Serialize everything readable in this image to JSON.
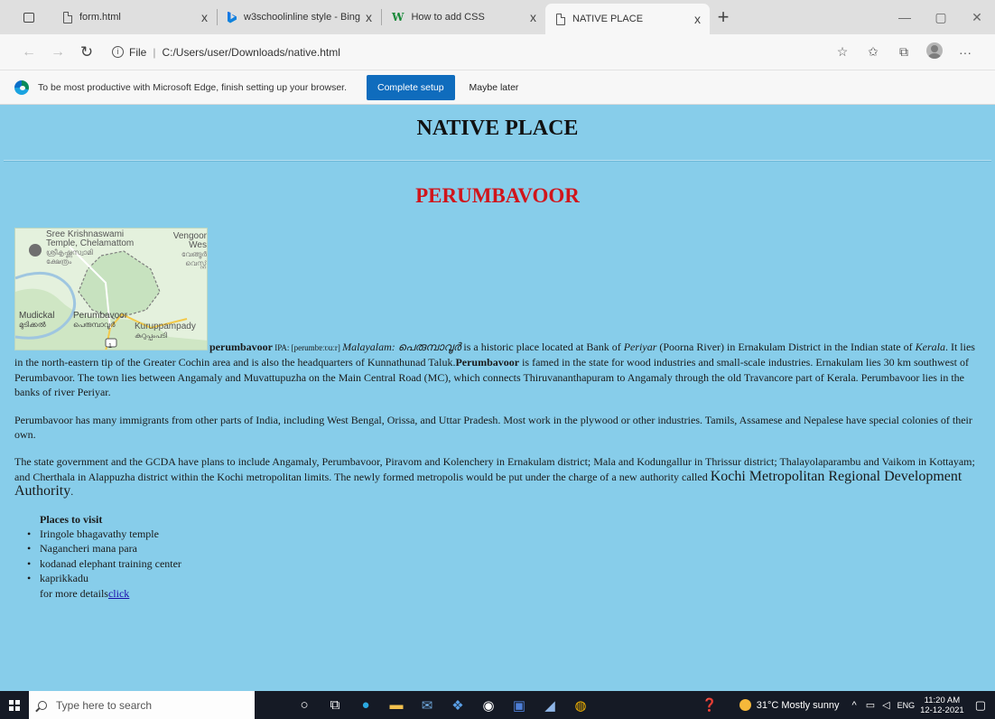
{
  "browser": {
    "tabs": [
      {
        "label": "form.html",
        "icon": "page-icon",
        "active": false
      },
      {
        "label": "w3schoolinline style - Bing",
        "icon": "bing-icon",
        "active": false
      },
      {
        "label": "How to add CSS",
        "icon": "w3-icon",
        "active": false
      },
      {
        "label": "NATIVE PLACE",
        "icon": "page-icon",
        "active": true
      }
    ],
    "tab_close": "x",
    "new_tab": "+",
    "address": {
      "scheme": "File",
      "separator": "|",
      "url": "C:/Users/user/Downloads/native.html"
    },
    "infobar": {
      "message": "To be most productive with Microsoft Edge, finish setting up your browser.",
      "primary_button": "Complete setup",
      "secondary_button": "Maybe later"
    }
  },
  "page": {
    "title": "NATIVE PLACE",
    "place_heading": "PERUMBAVOOR",
    "map_labels": {
      "temple_line1": "Sree Krishnaswami",
      "temple_line2": "Temple, Chelamattom",
      "temple_ml": "ശ്രീകൃഷ്ണസ്വാമി",
      "temple_ml2": "ക്ഷേത്രം",
      "vengoor": "Vengoor Wes",
      "vengoor_ml": "വേങ്ങൂർ",
      "vengoor_ml2": "വെസ്റ്റ്",
      "mudickal": "Mudickal",
      "mudickal_ml": "മുടിക്കൽ",
      "perumbavoor": "Perumbavoor",
      "perumbavoor_ml": "പെരുമ്പാവൂർ",
      "kuruppampady": "Kuruppampady",
      "kuruppampady_ml": "കുറുപ്പംപടി",
      "route": "1"
    },
    "para1": {
      "name": "perumbavoor",
      "ipa": " IPA: [perumbɐːʋuːr] ",
      "lang": "Malayalam: ",
      "ml_name": "പെരുമ്പാവൂർ",
      "t1": " is a historic place located at Bank of ",
      "periyar": "Periyar",
      "t2": " (Poorna River) in Ernakulam District in the Indian state of ",
      "kerala": "Kerala",
      "t3": ". It lies in the north-eastern tip of the Greater Cochin area and is also the headquarters of Kunnathunad Taluk.",
      "name2": "Perumbavoor",
      "t4": " is famed in the state for wood industries and small-scale industries. Ernakulam lies 30 km southwest of Perumbavoor. The town lies between Angamaly and Muvattupuzha on the Main Central Road (MC), which connects Thiruvananthapuram to Angamaly through the old Travancore part of Kerala. Perumbavoor lies in the banks of river Periyar."
    },
    "para2": "Perumbavoor has many immigrants from other parts of India, including West Bengal, Orissa, and Uttar Pradesh. Most work in the plywood or other industries. Tamils, Assamese and Nepalese have special colonies of their own.",
    "para3": {
      "text": "The state government and the GCDA have plans to include Angamaly, Perumbavoor, Piravom and Kolenchery in Ernakulam district; Mala and Kodungallur in Thrissur district; Thalayolaparambu and Vaikom in Kottayam; and Cherthala in Alappuzha district within the Kochi metropolitan limits. The newly formed metropolis would be put under the charge of a new authority called ",
      "authority": "Kochi Metropolitan Regional Development Authority",
      "end": "."
    },
    "places": {
      "title": "Places to visit",
      "items": [
        "Iringole bhagavathy temple",
        "Nagancheri mana para",
        "kodanad elephant training center",
        "kaprikkadu"
      ],
      "more_text": "for more details",
      "link_text": "click"
    }
  },
  "taskbar": {
    "search_placeholder": "Type here to search",
    "weather": "31°C  Mostly sunny",
    "lang": "ENG",
    "time": "11:20 AM",
    "date": "12-12-2021"
  }
}
